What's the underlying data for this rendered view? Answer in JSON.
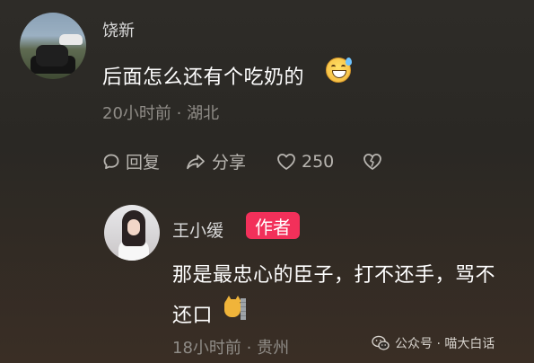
{
  "comment1": {
    "username": "饶新",
    "text": "后面怎么还有个吃奶的",
    "emoji": "grinning-sweat-emoji",
    "meta": "20小时前 · 湖北",
    "actions": {
      "reply": "回复",
      "share": "分享",
      "likes": "250"
    }
  },
  "comment2": {
    "username": "王小缓",
    "badge": "作者",
    "text_line1": "那是最忠心的臣子，打不还手，骂不",
    "text_line2": "还口",
    "emoji": "cat-behind-wall-emoji",
    "meta": "18小时前 · 贵州"
  },
  "watermark": {
    "text": "公众号 · 喵大白话"
  },
  "colors": {
    "badge_bg": "#f2305a",
    "meta_text": "#8f8c87",
    "action_text": "#b8b5b0"
  }
}
